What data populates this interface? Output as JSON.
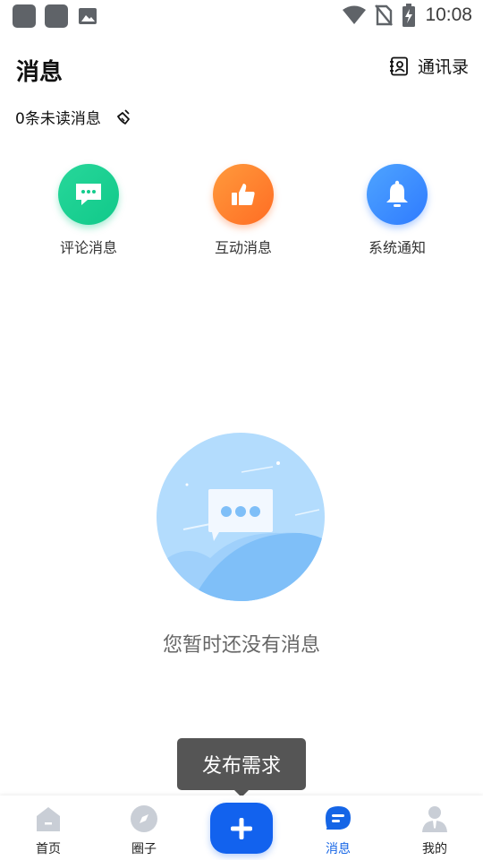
{
  "status_bar": {
    "time": "10:08",
    "icons": [
      "app-icon",
      "app-icon",
      "image-icon",
      "wifi-icon",
      "no-sim-icon",
      "battery-charging-icon"
    ]
  },
  "header": {
    "title": "消息",
    "contacts_label": "通讯录"
  },
  "unread": {
    "text": "0条未读消息"
  },
  "categories": [
    {
      "label": "评论消息",
      "icon": "comment-bubble-icon",
      "color": "#13cc8d"
    },
    {
      "label": "互动消息",
      "icon": "thumbs-up-icon",
      "color": "#ff7a2b"
    },
    {
      "label": "系统通知",
      "icon": "bell-icon",
      "color": "#3a8aff"
    }
  ],
  "empty_state": {
    "text": "您暂时还没有消息"
  },
  "tooltip": {
    "text": "发布需求"
  },
  "bottom_nav": {
    "items": [
      {
        "label": "首页",
        "icon": "home-icon",
        "active": false
      },
      {
        "label": "圈子",
        "icon": "compass-icon",
        "active": false
      },
      {
        "label": "消息",
        "icon": "message-icon",
        "active": true
      },
      {
        "label": "我的",
        "icon": "profile-icon",
        "active": false
      }
    ],
    "plus_icon": "plus-icon"
  },
  "colors": {
    "accent": "#1262ee",
    "active_text": "#1565e6",
    "tooltip_bg": "#555555"
  }
}
